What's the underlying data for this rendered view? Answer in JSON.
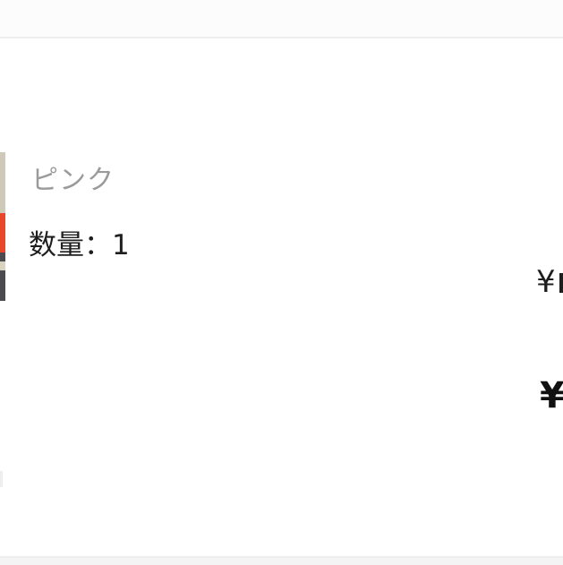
{
  "product": {
    "color_variant": "ピンク",
    "quantity_text": "数量：1",
    "unit_price_symbol": "¥",
    "total_price_symbol": "¥"
  },
  "colors": {
    "accent_red": "#e8472c",
    "text_dark": "#1e1e1e",
    "text_muted": "#9a9a9a",
    "divider": "#eeeeee"
  }
}
